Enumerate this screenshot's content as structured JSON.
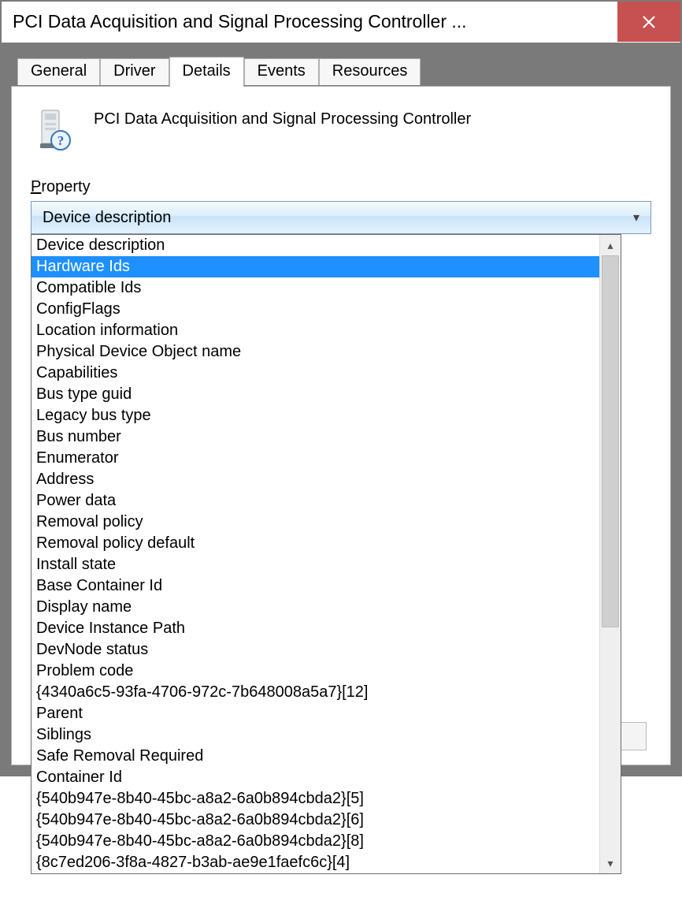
{
  "window": {
    "title": "PCI Data Acquisition and Signal Processing Controller ..."
  },
  "tabs": {
    "items": [
      {
        "label": "General"
      },
      {
        "label": "Driver"
      },
      {
        "label": "Details"
      },
      {
        "label": "Events"
      },
      {
        "label": "Resources"
      }
    ],
    "active_index": 2
  },
  "device": {
    "name": "PCI Data Acquisition and Signal Processing Controller"
  },
  "property_field": {
    "label_prefix": "P",
    "label_rest": "roperty",
    "selected": "Device description"
  },
  "dropdown": {
    "highlighted_index": 1,
    "items": [
      "Device description",
      "Hardware Ids",
      "Compatible Ids",
      "ConfigFlags",
      "Location information",
      "Physical Device Object name",
      "Capabilities",
      "Bus type guid",
      "Legacy bus type",
      "Bus number",
      "Enumerator",
      "Address",
      "Power data",
      "Removal policy",
      "Removal policy default",
      "Install state",
      "Base Container Id",
      "Display name",
      "Device Instance Path",
      "DevNode status",
      "Problem code",
      "{4340a6c5-93fa-4706-972c-7b648008a5a7}[12]",
      "Parent",
      "Siblings",
      "Safe Removal Required",
      "Container Id",
      "{540b947e-8b40-45bc-a8a2-6a0b894cbda2}[5]",
      "{540b947e-8b40-45bc-a8a2-6a0b894cbda2}[6]",
      "{540b947e-8b40-45bc-a8a2-6a0b894cbda2}[8]",
      "{8c7ed206-3f8a-4827-b3ab-ae9e1faefc6c}[4]"
    ]
  }
}
